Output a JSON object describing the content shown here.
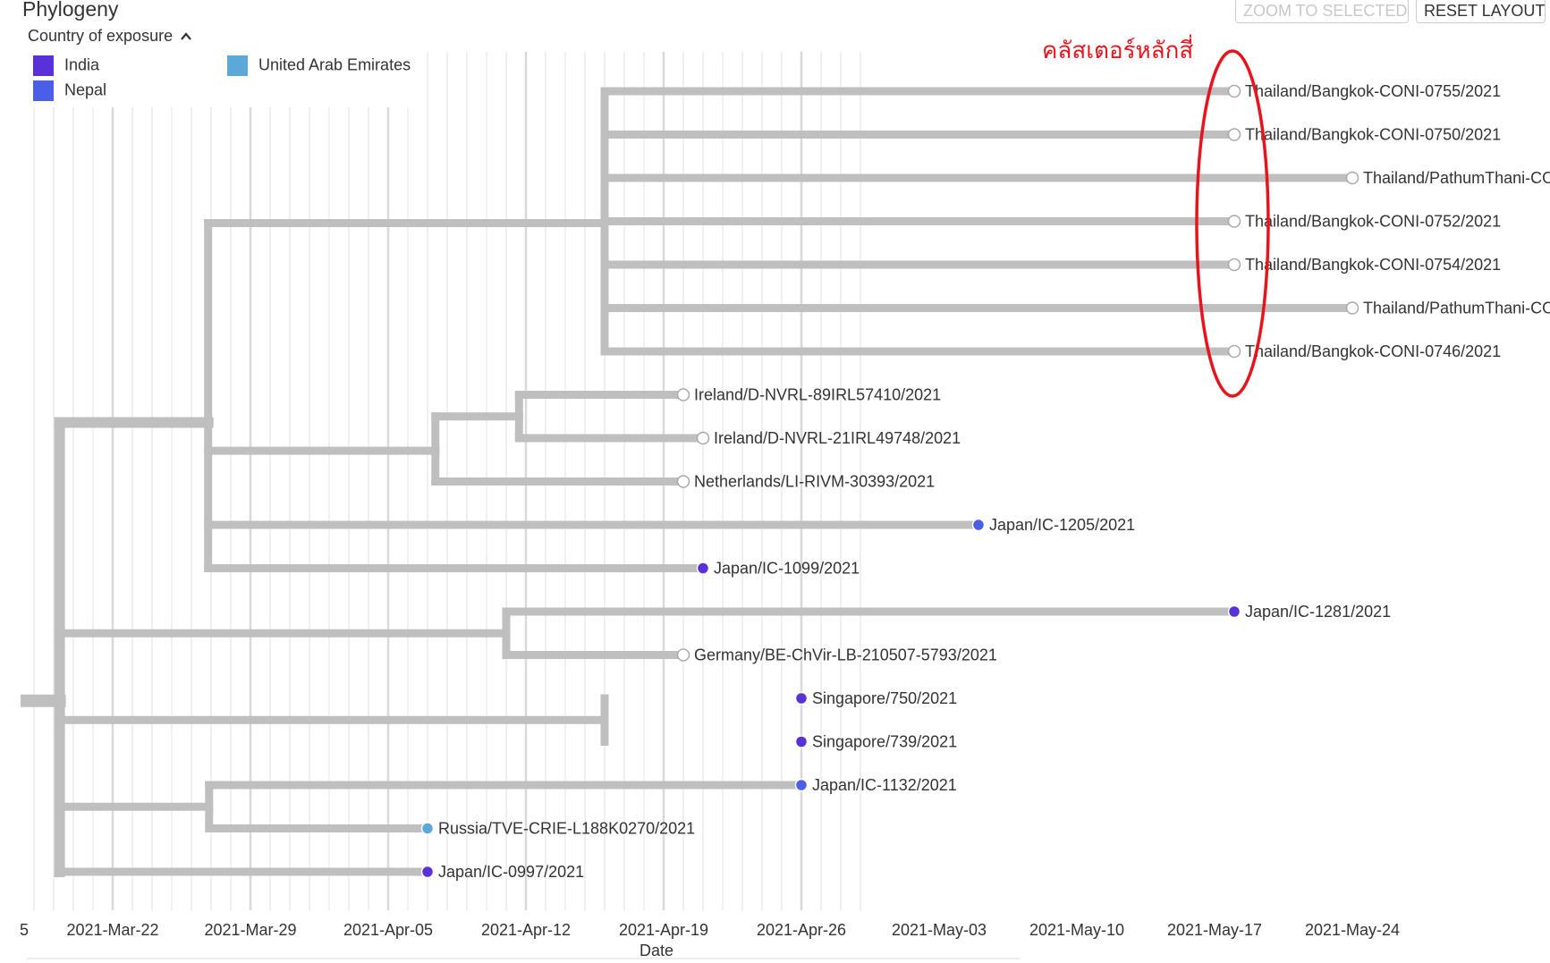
{
  "panel": {
    "title": "Phylogeny",
    "legend_toggle_label": "Country of exposure",
    "zoom_button": "ZOOM TO SELECTED",
    "reset_button": "RESET LAYOUT"
  },
  "legend": [
    {
      "label": "India",
      "color": "#5a30d8"
    },
    {
      "label": "Nepal",
      "color": "#4a5ee8"
    },
    {
      "label": "United Arab Emirates",
      "color": "#5ba8d9"
    }
  ],
  "annotation": {
    "text": "คลัสเตอร์หลักสี่",
    "color": "#e8141c"
  },
  "colors": {
    "branch": "#bfbfbf",
    "unknown_tip": "#d0d0d0",
    "grid_major": "#d9d9d9",
    "grid_minor": "#ececec"
  },
  "chart_data": {
    "type": "phylogenetic-tree",
    "xlabel": "Date",
    "x_ticks": [
      "2021-Mar-22",
      "2021-Mar-29",
      "2021-Apr-05",
      "2021-Apr-12",
      "2021-Apr-19",
      "2021-Apr-26",
      "2021-May-03",
      "2021-May-10",
      "2021-May-17",
      "2021-May-24"
    ],
    "edge_tick_label": "5",
    "x_ticks_truncated": [
      "2021-May-24"
    ],
    "tips": [
      {
        "name": "Thailand/Bangkok-CONI-0755/2021",
        "date": "2021-May-18",
        "country": null
      },
      {
        "name": "Thailand/Bangkok-CONI-0750/2021",
        "date": "2021-May-18",
        "country": null
      },
      {
        "name": "Thailand/PathumThani-CON",
        "date": "2021-May-24",
        "country": null
      },
      {
        "name": "Thailand/Bangkok-CONI-0752/2021",
        "date": "2021-May-18",
        "country": null
      },
      {
        "name": "Thailand/Bangkok-CONI-0754/2021",
        "date": "2021-May-18",
        "country": null
      },
      {
        "name": "Thailand/PathumThani-CON",
        "date": "2021-May-24",
        "country": null
      },
      {
        "name": "Thailand/Bangkok-CONI-0746/2021",
        "date": "2021-May-18",
        "country": null
      },
      {
        "name": "Ireland/D-NVRL-89IRL57410/2021",
        "date": "2021-Apr-20",
        "country": null
      },
      {
        "name": "Ireland/D-NVRL-21IRL49748/2021",
        "date": "2021-Apr-21",
        "country": null
      },
      {
        "name": "Netherlands/LI-RIVM-30393/2021",
        "date": "2021-Apr-20",
        "country": null
      },
      {
        "name": "Japan/IC-1205/2021",
        "date": "2021-May-05",
        "country": "Nepal"
      },
      {
        "name": "Japan/IC-1099/2021",
        "date": "2021-Apr-21",
        "country": "India"
      },
      {
        "name": "Japan/IC-1281/2021",
        "date": "2021-May-18",
        "country": "India"
      },
      {
        "name": "Germany/BE-ChVir-LB-210507-5793/2021",
        "date": "2021-Apr-20",
        "country": null
      },
      {
        "name": "Singapore/750/2021",
        "date": "2021-Apr-26",
        "country": "India"
      },
      {
        "name": "Singapore/739/2021",
        "date": "2021-Apr-26",
        "country": "India"
      },
      {
        "name": "Japan/IC-1132/2021",
        "date": "2021-Apr-26",
        "country": "Nepal"
      },
      {
        "name": "Russia/TVE-CRIE-L188K0270/2021",
        "date": "2021-Apr-07",
        "country": "United Arab Emirates"
      },
      {
        "name": "Japan/IC-0997/2021",
        "date": "2021-Apr-07",
        "country": "India"
      }
    ],
    "highlighted_cluster": [
      "Thailand/Bangkok-CONI-0755/2021",
      "Thailand/Bangkok-CONI-0750/2021",
      "Thailand/PathumThani-CON",
      "Thailand/Bangkok-CONI-0752/2021",
      "Thailand/Bangkok-CONI-0754/2021",
      "Thailand/PathumThani-CON",
      "Thailand/Bangkok-CONI-0746/2021"
    ]
  }
}
